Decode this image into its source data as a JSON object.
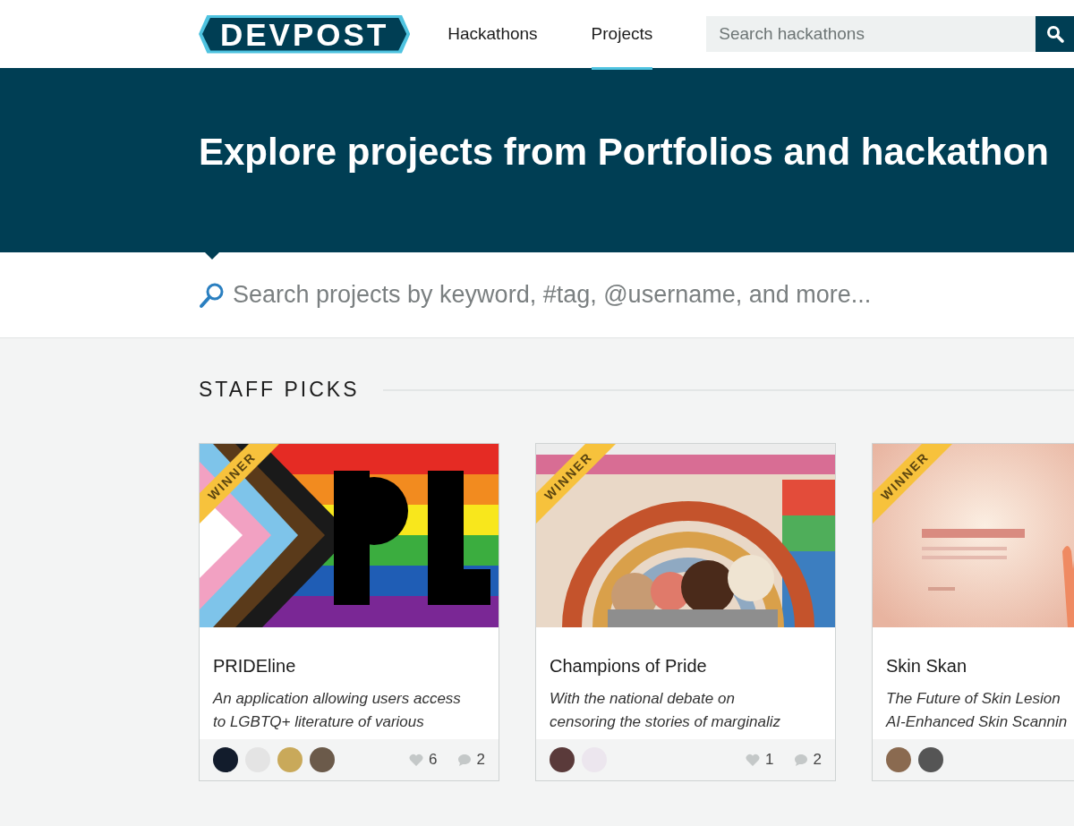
{
  "header": {
    "logo": "DEVPOST",
    "nav": [
      {
        "label": "Hackathons",
        "selected": false
      },
      {
        "label": "Projects",
        "selected": true
      }
    ],
    "search": {
      "placeholder": "Search hackathons"
    }
  },
  "hero": {
    "title": "Explore projects from Portfolios and hackathon"
  },
  "project_search": {
    "placeholder": "Search projects by keyword, #tag, @username, and more..."
  },
  "section": {
    "title": "STAFF PICKS"
  },
  "projects": [
    {
      "badge": "WINNER",
      "image": {
        "kind": "picture"
      },
      "title": "PRIDEline",
      "description": "An application allowing users access to LGBTQ+ literature of various",
      "avatars": [
        {
          "color": "#121c2c"
        },
        {
          "color": "#e4e4e4"
        },
        {
          "color": "#c9a95a"
        },
        {
          "color": "#6b5a4a"
        }
      ],
      "likes": "6",
      "comments": "2"
    },
    {
      "badge": "WINNER",
      "image": {
        "kind": "picture"
      },
      "title": "Champions of Pride",
      "description": "With the national debate on censoring the stories of marginaliz",
      "avatars": [
        {
          "color": "#5a3a3a"
        },
        {
          "color": "#ece6ee"
        }
      ],
      "likes": "1",
      "comments": "2"
    },
    {
      "badge": "WINNER",
      "image": {
        "kind": "picture"
      },
      "title": "Skin Skan",
      "description": "The Future of Skin Lesion AI-Enhanced Skin Scannin",
      "avatars": [
        {
          "color": "#8a6a50"
        },
        {
          "color": "#555555"
        }
      ]
    }
  ]
}
